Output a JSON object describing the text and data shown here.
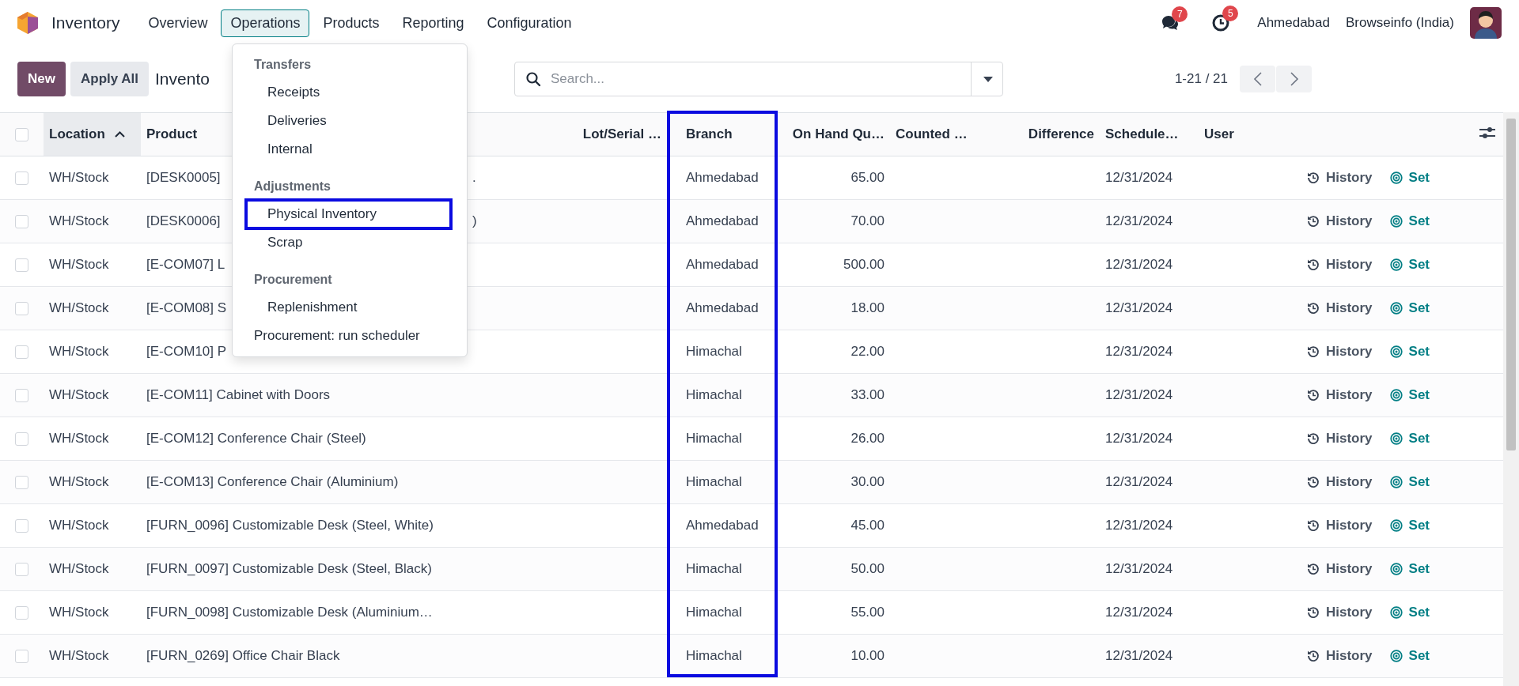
{
  "app": {
    "name": "Inventory"
  },
  "menu": [
    {
      "label": "Overview",
      "selected": false
    },
    {
      "label": "Operations",
      "selected": true
    },
    {
      "label": "Products",
      "selected": false
    },
    {
      "label": "Reporting",
      "selected": false
    },
    {
      "label": "Configuration",
      "selected": false
    }
  ],
  "systray": {
    "messages_badge": "7",
    "activities_badge": "5",
    "branch": "Ahmedabad",
    "company": "Browseinfo (India)"
  },
  "operations_menu": [
    {
      "kind": "header",
      "label": "Transfers"
    },
    {
      "kind": "item",
      "label": "Receipts",
      "highlighted": false
    },
    {
      "kind": "item",
      "label": "Deliveries",
      "highlighted": false
    },
    {
      "kind": "item",
      "label": "Internal",
      "highlighted": false
    },
    {
      "kind": "header",
      "label": "Adjustments"
    },
    {
      "kind": "item",
      "label": "Physical Inventory",
      "highlighted": true
    },
    {
      "kind": "item",
      "label": "Scrap",
      "highlighted": false
    },
    {
      "kind": "header",
      "label": "Procurement"
    },
    {
      "kind": "item",
      "label": "Replenishment",
      "highlighted": false
    },
    {
      "kind": "action",
      "label": "Procurement: run scheduler"
    }
  ],
  "control_panel": {
    "buttons": [
      "New",
      "Apply All"
    ],
    "breadcrumb": "Invento",
    "search": {
      "placeholder": "Search..."
    },
    "pager": "1-21 / 21"
  },
  "table": {
    "all_checked": false,
    "columns": [
      {
        "label": "Location",
        "sorted": true,
        "highlighted": false
      },
      {
        "label": "Product",
        "sorted": false,
        "highlighted": false
      },
      {
        "label": "Lot/Serial …",
        "sorted": false,
        "highlighted": false
      },
      {
        "label": "Branch",
        "sorted": false,
        "highlighted": true
      },
      {
        "label": "On Hand Qu…",
        "sorted": false,
        "highlighted": false
      },
      {
        "label": "Counted …",
        "sorted": false,
        "highlighted": false
      },
      {
        "label": "Difference",
        "sorted": false,
        "highlighted": false
      },
      {
        "label": "Schedule…",
        "sorted": false,
        "highlighted": false
      },
      {
        "label": "User",
        "sorted": false,
        "highlighted": false
      }
    ],
    "rows": [
      {
        "checked": false,
        "location": "WH/Stock",
        "product": "[DESK0005]",
        "product_tail": ".",
        "branch": "Ahmedabad",
        "on_hand": "65.00",
        "scheduled": "12/31/2024",
        "actions": [
          "History",
          "Set"
        ]
      },
      {
        "checked": false,
        "location": "WH/Stock",
        "product": "[DESK0006]",
        "product_tail": ")",
        "branch": "Ahmedabad",
        "on_hand": "70.00",
        "scheduled": "12/31/2024",
        "actions": [
          "History",
          "Set"
        ]
      },
      {
        "checked": false,
        "location": "WH/Stock",
        "product": "[E-COM07] L",
        "branch": "Ahmedabad",
        "on_hand": "500.00",
        "scheduled": "12/31/2024",
        "actions": [
          "History",
          "Set"
        ]
      },
      {
        "checked": false,
        "location": "WH/Stock",
        "product": "[E-COM08] S",
        "branch": "Ahmedabad",
        "on_hand": "18.00",
        "scheduled": "12/31/2024",
        "actions": [
          "History",
          "Set"
        ]
      },
      {
        "checked": false,
        "location": "WH/Stock",
        "product": "[E-COM10] P",
        "branch": "Himachal",
        "on_hand": "22.00",
        "scheduled": "12/31/2024",
        "actions": [
          "History",
          "Set"
        ]
      },
      {
        "checked": false,
        "location": "WH/Stock",
        "product": "[E-COM11] Cabinet with Doors",
        "branch": "Himachal",
        "on_hand": "33.00",
        "scheduled": "12/31/2024",
        "actions": [
          "History",
          "Set"
        ]
      },
      {
        "checked": false,
        "location": "WH/Stock",
        "product": "[E-COM12] Conference Chair (Steel)",
        "branch": "Himachal",
        "on_hand": "26.00",
        "scheduled": "12/31/2024",
        "actions": [
          "History",
          "Set"
        ]
      },
      {
        "checked": false,
        "location": "WH/Stock",
        "product": "[E-COM13] Conference Chair (Aluminium)",
        "branch": "Himachal",
        "on_hand": "30.00",
        "scheduled": "12/31/2024",
        "actions": [
          "History",
          "Set"
        ]
      },
      {
        "checked": false,
        "location": "WH/Stock",
        "product": "[FURN_0096] Customizable Desk (Steel, White)",
        "branch": "Ahmedabad",
        "on_hand": "45.00",
        "scheduled": "12/31/2024",
        "actions": [
          "History",
          "Set"
        ]
      },
      {
        "checked": false,
        "location": "WH/Stock",
        "product": "[FURN_0097] Customizable Desk (Steel, Black)",
        "branch": "Himachal",
        "on_hand": "50.00",
        "scheduled": "12/31/2024",
        "actions": [
          "History",
          "Set"
        ]
      },
      {
        "checked": false,
        "location": "WH/Stock",
        "product": "[FURN_0098] Customizable Desk (Aluminium…",
        "branch": "Himachal",
        "on_hand": "55.00",
        "scheduled": "12/31/2024",
        "actions": [
          "History",
          "Set"
        ]
      },
      {
        "checked": false,
        "location": "WH/Stock",
        "product": "[FURN_0269] Office Chair Black",
        "branch": "Himachal",
        "on_hand": "10.00",
        "scheduled": "12/31/2024",
        "actions": [
          "History",
          "Set"
        ]
      }
    ]
  }
}
